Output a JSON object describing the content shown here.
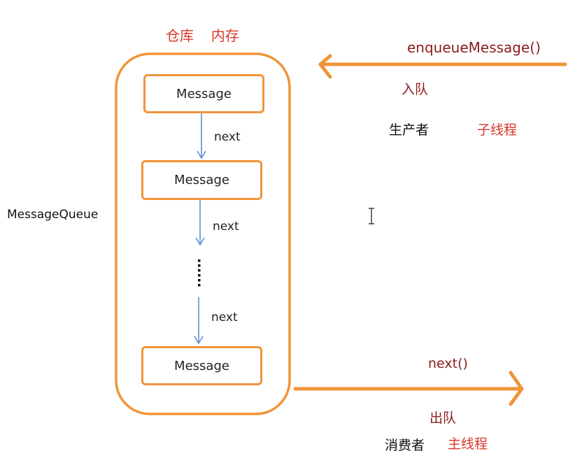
{
  "container": {
    "title_part1": "仓库",
    "title_part2": "内存",
    "side_label": "MessageQueue"
  },
  "messages": [
    {
      "label": "Message"
    },
    {
      "label": "Message"
    },
    {
      "label": "Message"
    }
  ],
  "links": [
    {
      "label": "next"
    },
    {
      "label": "next"
    },
    {
      "label": "next"
    }
  ],
  "producer": {
    "method": "enqueueMessage()",
    "action": "入队",
    "role": "生产者",
    "thread": "子线程"
  },
  "consumer": {
    "method": "next()",
    "action": "出队",
    "role": "消费者",
    "thread": "主线程"
  },
  "colors": {
    "orange": "#f0943a",
    "blue": "#5b8fd6",
    "red": "#d8362a",
    "dark_red": "#8b1a1a"
  }
}
